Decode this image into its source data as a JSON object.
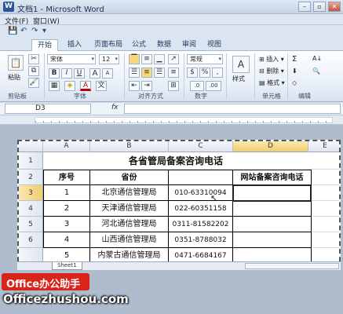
{
  "window": {
    "title": "文档1 - Microsoft Word",
    "app_icon_letter": "W",
    "minimize_glyph": "–",
    "restore_glyph": "▫",
    "close_glyph": "✕"
  },
  "menu": {
    "items": [
      "文件(F)",
      "窗口(W)"
    ]
  },
  "quick_access": {
    "save_glyph": "💾",
    "undo_glyph": "↶",
    "redo_glyph": "↷",
    "customize_glyph": "▾"
  },
  "ribbon": {
    "tabs": [
      {
        "label": "开始",
        "active": true
      },
      {
        "label": "插入"
      },
      {
        "label": "页面布局"
      },
      {
        "label": "公式"
      },
      {
        "label": "数据"
      },
      {
        "label": "审阅"
      },
      {
        "label": "视图"
      }
    ],
    "clipboard": {
      "paste": "粘贴",
      "group": "剪贴板"
    },
    "font": {
      "name": "宋体",
      "size": "12",
      "bold": "B",
      "italic": "I",
      "underline": "U",
      "grow": "A",
      "shrink": "A",
      "font_color": "A",
      "fill": "◈",
      "border": "▦",
      "group": "字体"
    },
    "alignment": {
      "group": "对齐方式",
      "wrap": "≡",
      "merge": "⊞"
    },
    "number": {
      "format": "常规",
      "currency": "$",
      "percent": "%",
      "comma": ",",
      "inc": ".0",
      "dec": ".00",
      "group": "数字"
    },
    "styles": {
      "label": "样式"
    },
    "cells": {
      "insert": "插入",
      "delete": "删除",
      "format": "格式",
      "group": "单元格"
    },
    "editing": {
      "sum": "Σ",
      "sort": "A↓",
      "find": "🔍",
      "fill": "⬇",
      "clear": "◇",
      "group": "编辑"
    }
  },
  "formula_bar": {
    "name_box": "D3",
    "fx": "fx"
  },
  "sheet": {
    "col_headers": [
      "A",
      "B",
      "C",
      "D",
      "E"
    ],
    "row_headers": [
      "1",
      "2",
      "3",
      "4",
      "5",
      "6"
    ],
    "title": "各省管局备案咨询电话",
    "headers": [
      "序号",
      "省份",
      "",
      "网站备案咨询电话"
    ],
    "rows": [
      [
        "1",
        "北京通信管理局",
        "010-63310094",
        ""
      ],
      [
        "2",
        "天津通信管理局",
        "022-60351158",
        ""
      ],
      [
        "3",
        "河北通信管理局",
        "0311-81582202",
        ""
      ],
      [
        "4",
        "山西通信管理局",
        "0351-8788032",
        ""
      ],
      [
        "5",
        "内蒙古通信管理局",
        "0471-6684167",
        ""
      ]
    ],
    "active_cell": "D3",
    "tab": "Sheet1"
  },
  "watermark": {
    "badge": "Office办公助手",
    "url": "Officezhushou.com"
  }
}
